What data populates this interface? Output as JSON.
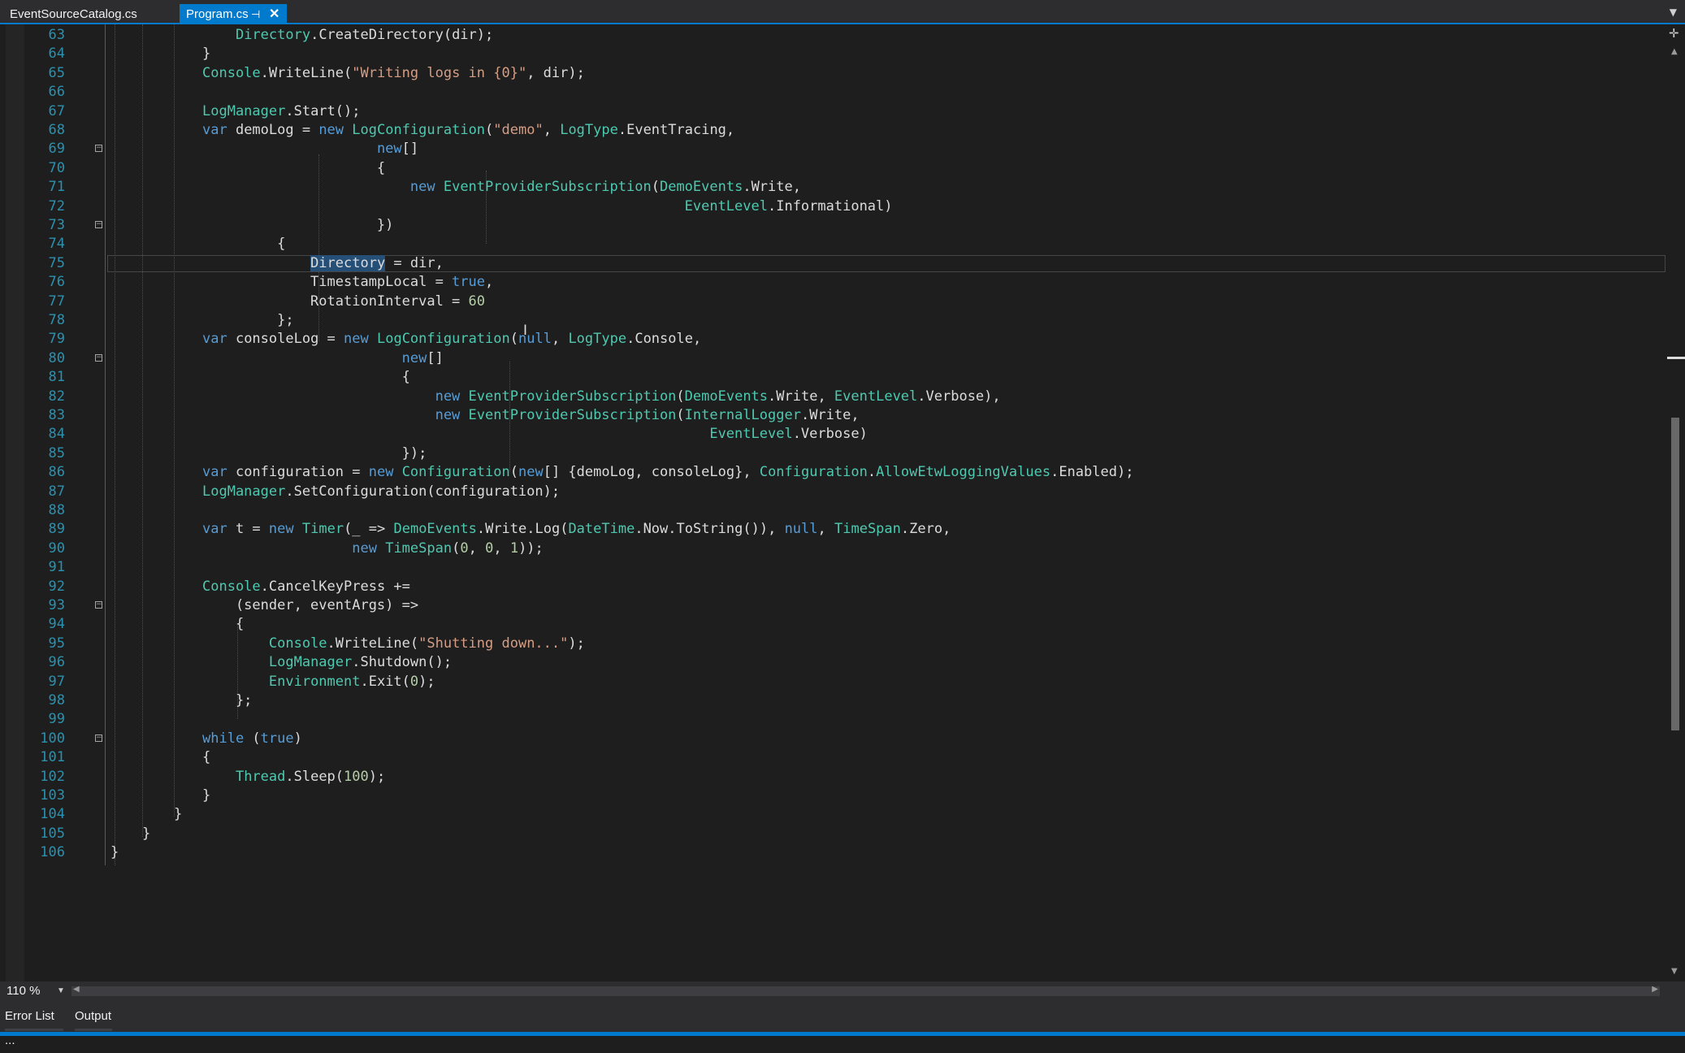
{
  "tabs": [
    {
      "label": "EventSourceCatalog.cs",
      "active": false
    },
    {
      "label": "Program.cs",
      "active": true
    }
  ],
  "tab_icons": {
    "pin": "pin-icon",
    "close": "close-icon",
    "dropdown": "chevron-down-icon"
  },
  "colors": {
    "background": "#1e1e1e",
    "accent": "#007acc",
    "keyword": "#569cd6",
    "type": "#4ec9b0",
    "string": "#d69d85",
    "number": "#b5cea8",
    "line_number": "#2b91af",
    "selection": "#264f78"
  },
  "editor": {
    "current_line": 75,
    "folded_lines": [
      69,
      73,
      80,
      93,
      100
    ],
    "lines": [
      {
        "n": "63",
        "segs": [
          [
            "p",
            "    "
          ],
          [
            "ty",
            "Directory"
          ],
          [
            "p",
            ".CreateDirectory(dir);"
          ]
        ]
      },
      {
        "n": "64",
        "segs": [
          [
            "p",
            "}"
          ]
        ]
      },
      {
        "n": "65",
        "segs": [
          [
            "ty",
            "Console"
          ],
          [
            "p",
            ".WriteLine("
          ],
          [
            "st",
            "\"Writing logs in {0}\""
          ],
          [
            "p",
            ", dir);"
          ]
        ]
      },
      {
        "n": "66",
        "segs": []
      },
      {
        "n": "67",
        "segs": [
          [
            "ty",
            "LogManager"
          ],
          [
            "p",
            ".Start();"
          ]
        ]
      },
      {
        "n": "68",
        "segs": [
          [
            "kw",
            "var"
          ],
          [
            "p",
            " demoLog = "
          ],
          [
            "kw",
            "new"
          ],
          [
            "p",
            " "
          ],
          [
            "ty",
            "LogConfiguration"
          ],
          [
            "p",
            "("
          ],
          [
            "st",
            "\"demo\""
          ],
          [
            "p",
            ", "
          ],
          [
            "ty",
            "LogType"
          ],
          [
            "p",
            ".EventTracing,"
          ]
        ]
      },
      {
        "n": "69",
        "segs": [
          [
            "p",
            "                     "
          ],
          [
            "kw",
            "new"
          ],
          [
            "p",
            "[]"
          ]
        ]
      },
      {
        "n": "70",
        "segs": [
          [
            "p",
            "                     {"
          ]
        ]
      },
      {
        "n": "71",
        "segs": [
          [
            "p",
            "                         "
          ],
          [
            "kw",
            "new"
          ],
          [
            "p",
            " "
          ],
          [
            "ty",
            "EventProviderSubscription"
          ],
          [
            "p",
            "("
          ],
          [
            "ty",
            "DemoEvents"
          ],
          [
            "p",
            ".Write,"
          ]
        ]
      },
      {
        "n": "72",
        "segs": [
          [
            "p",
            "                                                          "
          ],
          [
            "ty",
            "EventLevel"
          ],
          [
            "p",
            ".Informational)"
          ]
        ]
      },
      {
        "n": "73",
        "segs": [
          [
            "p",
            "                     })"
          ]
        ]
      },
      {
        "n": "74",
        "segs": [
          [
            "p",
            "         {"
          ]
        ]
      },
      {
        "n": "75",
        "segs": [
          [
            "p",
            "             "
          ],
          [
            "sel",
            "Directory"
          ],
          [
            "p",
            " = dir,"
          ]
        ]
      },
      {
        "n": "76",
        "segs": [
          [
            "p",
            "             TimestampLocal = "
          ],
          [
            "kw",
            "true"
          ],
          [
            "p",
            ","
          ]
        ]
      },
      {
        "n": "77",
        "segs": [
          [
            "p",
            "             RotationInterval = "
          ],
          [
            "nu",
            "60"
          ]
        ]
      },
      {
        "n": "78",
        "segs": [
          [
            "p",
            "         };"
          ]
        ]
      },
      {
        "n": "79",
        "segs": [
          [
            "kw",
            "var"
          ],
          [
            "p",
            " consoleLog = "
          ],
          [
            "kw",
            "new"
          ],
          [
            "p",
            " "
          ],
          [
            "ty",
            "LogConfiguration"
          ],
          [
            "p",
            "("
          ],
          [
            "kw",
            "null"
          ],
          [
            "p",
            ", "
          ],
          [
            "ty",
            "LogType"
          ],
          [
            "p",
            ".Console,"
          ]
        ]
      },
      {
        "n": "80",
        "segs": [
          [
            "p",
            "                        "
          ],
          [
            "kw",
            "new"
          ],
          [
            "p",
            "[]"
          ]
        ]
      },
      {
        "n": "81",
        "segs": [
          [
            "p",
            "                        {"
          ]
        ]
      },
      {
        "n": "82",
        "segs": [
          [
            "p",
            "                            "
          ],
          [
            "kw",
            "new"
          ],
          [
            "p",
            " "
          ],
          [
            "ty",
            "EventProviderSubscription"
          ],
          [
            "p",
            "("
          ],
          [
            "ty",
            "DemoEvents"
          ],
          [
            "p",
            ".Write, "
          ],
          [
            "ty",
            "EventLevel"
          ],
          [
            "p",
            ".Verbose),"
          ]
        ]
      },
      {
        "n": "83",
        "segs": [
          [
            "p",
            "                            "
          ],
          [
            "kw",
            "new"
          ],
          [
            "p",
            " "
          ],
          [
            "ty",
            "EventProviderSubscription"
          ],
          [
            "p",
            "("
          ],
          [
            "ty",
            "InternalLogger"
          ],
          [
            "p",
            ".Write,"
          ]
        ]
      },
      {
        "n": "84",
        "segs": [
          [
            "p",
            "                                                             "
          ],
          [
            "ty",
            "EventLevel"
          ],
          [
            "p",
            ".Verbose)"
          ]
        ]
      },
      {
        "n": "85",
        "segs": [
          [
            "p",
            "                        });"
          ]
        ]
      },
      {
        "n": "86",
        "segs": [
          [
            "kw",
            "var"
          ],
          [
            "p",
            " configuration = "
          ],
          [
            "kw",
            "new"
          ],
          [
            "p",
            " "
          ],
          [
            "ty",
            "Configuration"
          ],
          [
            "p",
            "("
          ],
          [
            "kw",
            "new"
          ],
          [
            "p",
            "[] {demoLog, consoleLog}, "
          ],
          [
            "ty",
            "Configuration"
          ],
          [
            "p",
            "."
          ],
          [
            "ty",
            "AllowEtwLoggingValues"
          ],
          [
            "p",
            ".Enabled);"
          ]
        ]
      },
      {
        "n": "87",
        "segs": [
          [
            "ty",
            "LogManager"
          ],
          [
            "p",
            ".SetConfiguration(configuration);"
          ]
        ]
      },
      {
        "n": "88",
        "segs": []
      },
      {
        "n": "89",
        "segs": [
          [
            "kw",
            "var"
          ],
          [
            "p",
            " t = "
          ],
          [
            "kw",
            "new"
          ],
          [
            "p",
            " "
          ],
          [
            "ty",
            "Timer"
          ],
          [
            "p",
            "(_ => "
          ],
          [
            "ty",
            "DemoEvents"
          ],
          [
            "p",
            ".Write.Log("
          ],
          [
            "ty",
            "DateTime"
          ],
          [
            "p",
            ".Now.ToString()), "
          ],
          [
            "kw",
            "null"
          ],
          [
            "p",
            ", "
          ],
          [
            "ty",
            "TimeSpan"
          ],
          [
            "p",
            ".Zero,"
          ]
        ]
      },
      {
        "n": "90",
        "segs": [
          [
            "p",
            "                  "
          ],
          [
            "kw",
            "new"
          ],
          [
            "p",
            " "
          ],
          [
            "ty",
            "TimeSpan"
          ],
          [
            "p",
            "("
          ],
          [
            "nu",
            "0"
          ],
          [
            "p",
            ", "
          ],
          [
            "nu",
            "0"
          ],
          [
            "p",
            ", "
          ],
          [
            "nu",
            "1"
          ],
          [
            "p",
            "));"
          ]
        ]
      },
      {
        "n": "91",
        "segs": []
      },
      {
        "n": "92",
        "segs": [
          [
            "ty",
            "Console"
          ],
          [
            "p",
            ".CancelKeyPress +="
          ]
        ]
      },
      {
        "n": "93",
        "segs": [
          [
            "p",
            "    (sender, eventArgs) =>"
          ]
        ]
      },
      {
        "n": "94",
        "segs": [
          [
            "p",
            "    {"
          ]
        ]
      },
      {
        "n": "95",
        "segs": [
          [
            "p",
            "        "
          ],
          [
            "ty",
            "Console"
          ],
          [
            "p",
            ".WriteLine("
          ],
          [
            "st",
            "\"Shutting down...\""
          ],
          [
            "p",
            ");"
          ]
        ]
      },
      {
        "n": "96",
        "segs": [
          [
            "p",
            "        "
          ],
          [
            "ty",
            "LogManager"
          ],
          [
            "p",
            ".Shutdown();"
          ]
        ]
      },
      {
        "n": "97",
        "segs": [
          [
            "p",
            "        "
          ],
          [
            "ty",
            "Environment"
          ],
          [
            "p",
            ".Exit("
          ],
          [
            "nu",
            "0"
          ],
          [
            "p",
            ");"
          ]
        ]
      },
      {
        "n": "98",
        "segs": [
          [
            "p",
            "    };"
          ]
        ]
      },
      {
        "n": "99",
        "segs": []
      },
      {
        "n": "100",
        "segs": [
          [
            "kw",
            "while"
          ],
          [
            "p",
            " ("
          ],
          [
            "kw",
            "true"
          ],
          [
            "p",
            ")"
          ]
        ]
      },
      {
        "n": "101",
        "segs": [
          [
            "p",
            "{"
          ]
        ]
      },
      {
        "n": "102",
        "segs": [
          [
            "p",
            "    "
          ],
          [
            "ty",
            "Thread"
          ],
          [
            "p",
            ".Sleep("
          ],
          [
            "nu",
            "100"
          ],
          [
            "p",
            ");"
          ]
        ]
      },
      {
        "n": "103",
        "segs": [
          [
            "p",
            "}"
          ]
        ]
      },
      {
        "n": "104",
        "segs": [
          [
            "p",
            "}"
          ]
        ]
      },
      {
        "n": "105",
        "segs": [
          [
            "p",
            "}"
          ]
        ]
      },
      {
        "n": "106",
        "segs": [
          [
            "p",
            "}"
          ]
        ]
      }
    ]
  },
  "zoom": {
    "value": "110 %"
  },
  "bottom_tabs": [
    {
      "label": "Error List ..."
    },
    {
      "label": "Output"
    }
  ]
}
